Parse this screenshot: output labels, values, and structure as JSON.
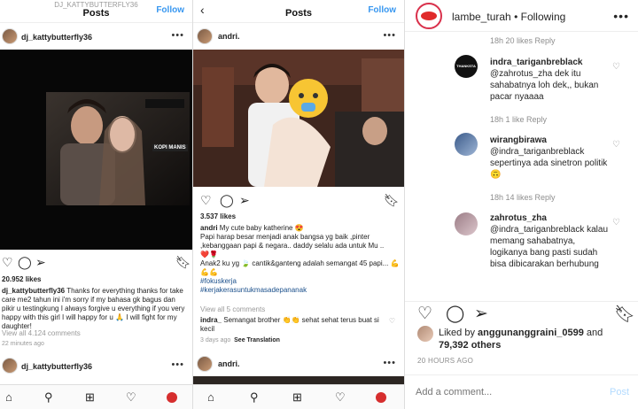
{
  "left_panel": {
    "header_sub": "DJ_KATTYBUTTERFLY36",
    "header_title": "Posts",
    "follow": "Follow",
    "username": "dj_kattybutterfly36",
    "watermark": "KOPI MANIS",
    "likes": "20.952 likes",
    "caption_user": "dj_kattybutterfly36",
    "caption_text": "Thanks for everything thanks for take care me2 tahun ini i'm sorry if my bahasa gk bagus dan pikir u testingkung I always forgive u everything if you very happy with this girl I will happy for u 🙏 I will fight for my daughter!",
    "view_comments": "View all 4.124 comments",
    "time_ago": "22 minutes ago",
    "next_username": "dj_kattybutterfly36"
  },
  "middle_panel": {
    "header_title": "Posts",
    "follow": "Follow",
    "username": "andri.",
    "likes": "3.537 likes",
    "caption_user": "andri",
    "caption_line1": "My cute baby katherine 😍",
    "caption_text": "Papi harap besar menjadi anak bangsa yg baik ,pinter ,kebanggaan papi & negara.. daddy selalu ada untuk Mu ..",
    "caption_hearts": "❤️🌹",
    "caption_line2": "Anak2 ku yg 🍃 cantik&ganteng adalah semangat 45 papi... 💪💪💪",
    "hashtag1": "#fokuskerja",
    "hashtag2": "#kerjakerasuntukmasadepananak",
    "view_comments": "View all 5 comments",
    "comment_user": "indra_",
    "comment_text": "Semangat brother 👏👏 sehat sehat terus buat si kecil",
    "time_ago": "3 days ago",
    "see_translation": "See Translation",
    "next_username": "andri."
  },
  "right_panel": {
    "account": "lambe_turah",
    "following": "Following",
    "top_meta": "18h   20 likes   Reply",
    "comments": [
      {
        "user": "indra_tariganbreblack",
        "text": "@zahrotus_zha dek itu sahabatnya loh dek,, bukan pacar nyaaaa",
        "meta": "18h    1 like    Reply"
      },
      {
        "user": "wirangbirawa",
        "text": "@indra_tariganbreblack sepertinya ada sinetron politik 🙃",
        "meta": "18h    14 likes    Reply"
      },
      {
        "user": "zahrotus_zha",
        "text": "@indra_tariganbreblack kalau memang sahabatnya, logikanya bang pasti sudah bisa dibicarakan berhubung",
        "meta": ""
      }
    ],
    "liked_by_prefix": "Liked by ",
    "liked_by_user": "anggunanggraini_0599",
    "liked_by_and": " and",
    "others": "79,392 others",
    "time": "20 HOURS AGO",
    "add_comment_placeholder": "Add a comment...",
    "post": "Post",
    "avatar_badge_text": "THANKSTA"
  }
}
